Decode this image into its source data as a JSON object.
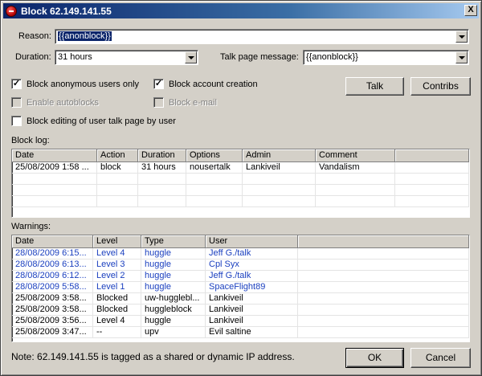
{
  "window": {
    "title": "Block 62.149.141.55",
    "close_glyph": "X"
  },
  "form": {
    "reason_label": "Reason:",
    "reason_value": "{{anonblock}}",
    "duration_label": "Duration:",
    "duration_value": "31 hours",
    "talk_msg_label": "Talk page message:",
    "talk_msg_value": "{{anonblock}}"
  },
  "options": {
    "anon_only": {
      "label": "Block anonymous users only",
      "checked": true
    },
    "account_creation": {
      "label": "Block account creation",
      "checked": true
    },
    "autoblocks": {
      "label": "Enable autoblocks",
      "checked": false,
      "disabled": true
    },
    "email": {
      "label": "Block e-mail",
      "checked": false,
      "disabled": true
    },
    "talk_edit": {
      "label": "Block editing of user talk page by user",
      "checked": false
    }
  },
  "buttons": {
    "talk": "Talk",
    "contribs": "Contribs",
    "ok": "OK",
    "cancel": "Cancel"
  },
  "block_log": {
    "label": "Block log:",
    "columns": [
      "Date",
      "Action",
      "Duration",
      "Options",
      "Admin",
      "Comment"
    ],
    "rows": [
      [
        "25/08/2009 1:58 ...",
        "block",
        "31 hours",
        "nousertalk",
        "Lankiveil",
        "Vandalism"
      ]
    ]
  },
  "warnings": {
    "label": "Warnings:",
    "columns": [
      "Date",
      "Level",
      "Type",
      "User"
    ],
    "rows": [
      {
        "cells": [
          "28/08/2009 6:15...",
          "Level 4",
          "huggle",
          "Jeff G./talk"
        ],
        "style": "blue"
      },
      {
        "cells": [
          "28/08/2009 6:13...",
          "Level 3",
          "huggle",
          "Cpl Syx"
        ],
        "style": "blue"
      },
      {
        "cells": [
          "28/08/2009 6:12...",
          "Level 2",
          "huggle",
          "Jeff G./talk"
        ],
        "style": "blue"
      },
      {
        "cells": [
          "28/08/2009 5:58...",
          "Level 1",
          "huggle",
          "SpaceFlight89"
        ],
        "style": "blue"
      },
      {
        "cells": [
          "25/08/2009 3:58...",
          "Blocked",
          "uw-hugglebl...",
          "Lankiveil"
        ],
        "style": "black"
      },
      {
        "cells": [
          "25/08/2009 3:58...",
          "Blocked",
          "huggleblock",
          "Lankiveil"
        ],
        "style": "black"
      },
      {
        "cells": [
          "25/08/2009 3:56...",
          "Level 4",
          "huggle",
          "Lankiveil"
        ],
        "style": "black"
      },
      {
        "cells": [
          "25/08/2009 3:47...",
          "--",
          "upv",
          "Evil saltine"
        ],
        "style": "black"
      }
    ]
  },
  "note": "Note: 62.149.141.55 is tagged as a shared or dynamic IP address.",
  "colors": {
    "title_start": "#0a246a",
    "title_end": "#a6caf0",
    "link_blue": "#1a3fbf",
    "face": "#d4d0c8"
  }
}
